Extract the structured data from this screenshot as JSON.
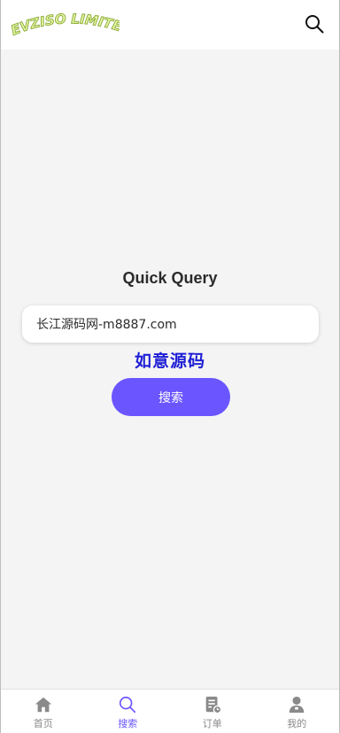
{
  "header": {
    "logo_text": "EVZISO LIMITED",
    "search_icon": "search-icon"
  },
  "main": {
    "title": "Quick Query",
    "query_value": "长江源码网-m8887.com",
    "watermark": "如意源码",
    "submit_label": "搜索"
  },
  "tabbar": {
    "items": [
      {
        "label": "首页",
        "icon": "home-icon",
        "active": false
      },
      {
        "label": "搜索",
        "icon": "search-icon",
        "active": true
      },
      {
        "label": "订单",
        "icon": "order-icon",
        "active": false
      },
      {
        "label": "我的",
        "icon": "user-icon",
        "active": false
      }
    ]
  },
  "colors": {
    "accent": "#6a55ff",
    "logo_fill": "#e3f7a6",
    "logo_stroke": "#8aa832",
    "watermark": "#1f1fd6",
    "icon_gray": "#8a8a8a"
  }
}
